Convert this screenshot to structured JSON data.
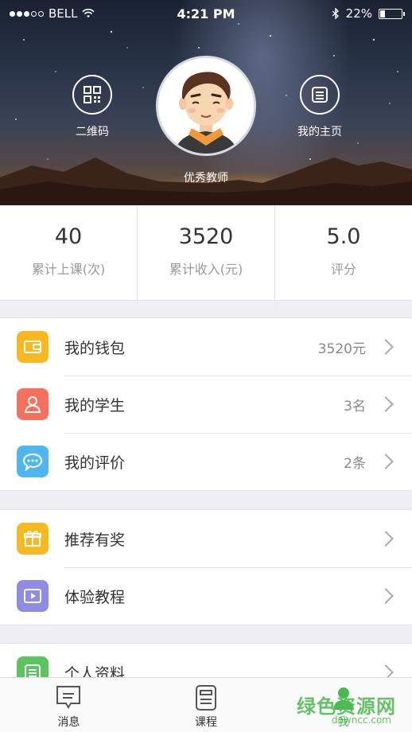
{
  "status_bar": {
    "carrier": "BELL",
    "time": "4:21 PM",
    "battery": "22%",
    "battery_level": 0.22
  },
  "header": {
    "qr_label": "二维码",
    "qr_icon": "qr-code-icon",
    "homepage_label": "我的主页",
    "homepage_icon": "document-icon",
    "teacher_name": "优秀教师"
  },
  "stats": [
    {
      "value": "40",
      "label": "累计上课(次)"
    },
    {
      "value": "3520",
      "label": "累计收入(元)"
    },
    {
      "value": "5.0",
      "label": "评分"
    }
  ],
  "menu": {
    "wallet": {
      "label": "我的钱包",
      "value": "3520元",
      "icon": "wallet-icon",
      "color": "#f8b820"
    },
    "students": {
      "label": "我的学生",
      "value": "3名",
      "icon": "person-icon",
      "color": "#f5715e"
    },
    "reviews": {
      "label": "我的评价",
      "value": "2条",
      "icon": "chat-icon",
      "color": "#4fb6f0"
    },
    "referral": {
      "label": "推荐有奖",
      "icon": "gift-icon",
      "color": "#f8b820"
    },
    "tutorial": {
      "label": "体验教程",
      "icon": "play-icon",
      "color": "#8f8ce6"
    },
    "profile": {
      "label": "个人资料",
      "icon": "profile-icon",
      "color": "#5cc45e"
    }
  },
  "tabbar": {
    "messages": "消息",
    "courses": "课程",
    "me": "我",
    "active_color": "#48b852"
  },
  "watermark": {
    "text": "绿色资源网",
    "url": "downcc.com"
  }
}
